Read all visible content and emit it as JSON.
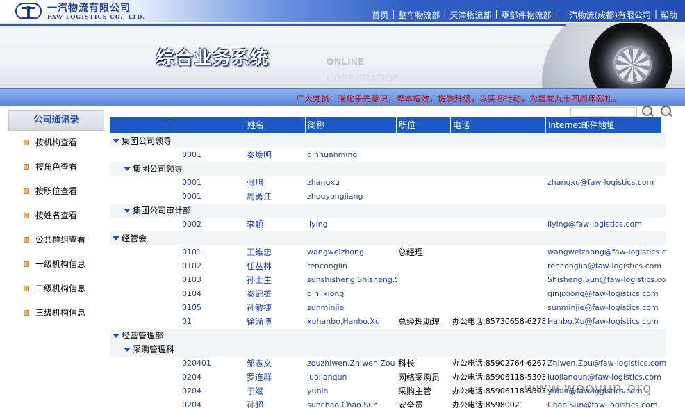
{
  "header": {
    "company_cn": "一汽物流有限公司",
    "company_en": "FAW LOGISTICS CO., LTD.",
    "nav": [
      "首页",
      "整车物流部",
      "天津物流部",
      "零部件物流部",
      "一汽物流(成都)有限公司",
      "帮助"
    ]
  },
  "banner": {
    "title": "综合业务系统",
    "online": "ONLINE",
    "corp": "CORPORATION"
  },
  "notice": "广大党员：强化争先意识，降本增效，提质升级，以实际行动，为建党九十四周年献礼。",
  "sidebar": {
    "title": "公司通讯录",
    "items": [
      "按机构查看",
      "按角色查看",
      "按职位查看",
      "按姓名查看",
      "公共群组查看",
      "一级机构信息",
      "二级机构信息",
      "三级机构信息"
    ]
  },
  "table": {
    "headers": [
      "",
      "",
      "姓名",
      "简称",
      "职位",
      "电话",
      "Internet邮件地址"
    ],
    "rows": [
      {
        "type": "group",
        "level": 0,
        "label": "集团公司领导"
      },
      {
        "type": "person",
        "id": "0001",
        "name": "秦焕明",
        "pinyin": "qinhuanming",
        "position": "",
        "phone": "",
        "email": ""
      },
      {
        "type": "group",
        "level": 1,
        "label": "集团公司领导"
      },
      {
        "type": "person",
        "id": "0001",
        "name": "张旭",
        "pinyin": "zhangxu",
        "position": "",
        "phone": "",
        "email": "zhangxu@faw-logistics.com"
      },
      {
        "type": "person",
        "id": "0001",
        "name": "周勇江",
        "pinyin": "zhouyongjiang",
        "position": "",
        "phone": "",
        "email": ""
      },
      {
        "type": "group",
        "level": 1,
        "label": "集团公司审计部"
      },
      {
        "type": "person",
        "id": "0002",
        "name": "李颖",
        "pinyin": "liying",
        "position": "",
        "phone": "",
        "email": "liying@faw-logistics.com"
      },
      {
        "type": "group",
        "level": 0,
        "label": "经管会"
      },
      {
        "type": "person",
        "id": "0101",
        "name": "王维忠",
        "pinyin": "wangweizhong",
        "position": "总经理",
        "phone": "",
        "email": "wangweizhong@faw-logistics.com"
      },
      {
        "type": "person",
        "id": "0102",
        "name": "任丛林",
        "pinyin": "renconglin",
        "position": "",
        "phone": "",
        "email": "renconglin@faw-logistics.com"
      },
      {
        "type": "person",
        "id": "0103",
        "name": "孙士生",
        "pinyin": "sunshisheng,Shisheng.Sun",
        "position": "",
        "phone": "",
        "email": "Shisheng.Sun@faw-logistics.com"
      },
      {
        "type": "person",
        "id": "0104",
        "name": "秦记雄",
        "pinyin": "qinjixiong",
        "position": "",
        "phone": "",
        "email": "qinjixiong@faw-logistics.com"
      },
      {
        "type": "person",
        "id": "0105",
        "name": "孙敏捷",
        "pinyin": "sunminjie",
        "position": "",
        "phone": "",
        "email": "sunminjie@faw-logistics.com"
      },
      {
        "type": "person",
        "id": "01",
        "name": "徐涵博",
        "pinyin": "xuhanbo,Hanbo.Xu",
        "position": "总经理助理",
        "phone": "办公电话:85730658-6278",
        "email": "Hanbo.Xu@faw-logistics.com"
      },
      {
        "type": "group",
        "level": 0,
        "label": "经营管理部"
      },
      {
        "type": "group",
        "level": 1,
        "label": "采购管理科"
      },
      {
        "type": "person",
        "id": "020401",
        "name": "邹志文",
        "pinyin": "zouzhiwen,Zhiwen.Zou",
        "position": "科长",
        "phone": "办公电话:85902764-6267",
        "email": "Zhiwen.Zou@faw-logistics.com"
      },
      {
        "type": "person",
        "id": "0204",
        "name": "罗连群",
        "pinyin": "luolianqun",
        "position": "网络采购员",
        "phone": "办公电话:85906118-5303",
        "email": "luolianqun@faw-logistics.com"
      },
      {
        "type": "person",
        "id": "0204",
        "name": "于斌",
        "pinyin": "yubin",
        "position": "采购主管",
        "phone": "办公电话:85906118-5303",
        "email": "yubin@faw-logistics.com"
      },
      {
        "type": "person",
        "id": "0204",
        "name": "孙超",
        "pinyin": "sunchao,Chao.Sun",
        "position": "安全员",
        "phone": "办公电话:85980021",
        "email": "Chao.Sun@faw-logistics.com"
      }
    ]
  },
  "watermark": "www.wooyun.org"
}
